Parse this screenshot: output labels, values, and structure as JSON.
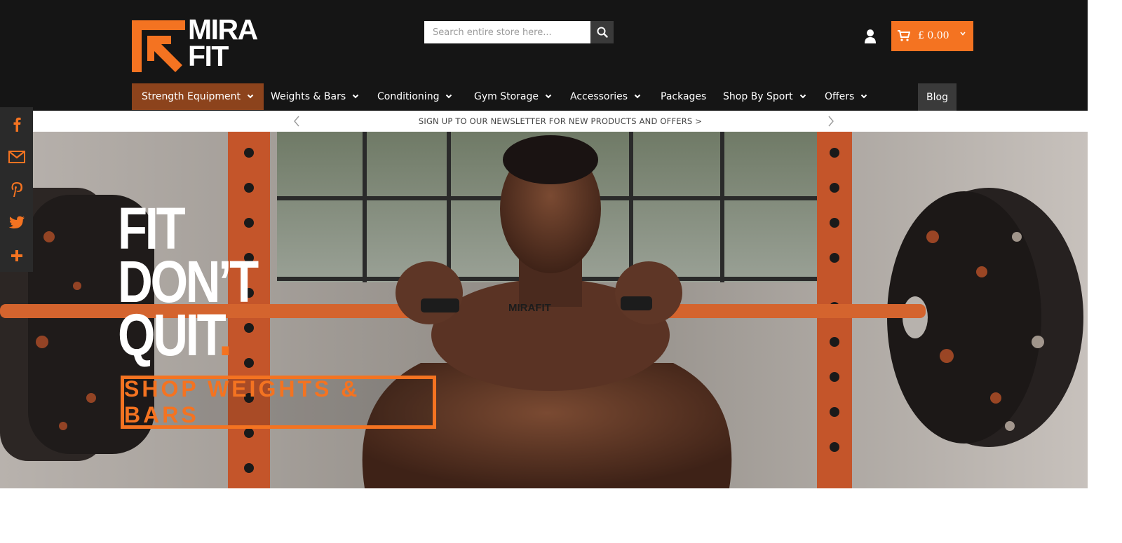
{
  "brand": {
    "logo_line1": "MIRA",
    "logo_line2": "FIT",
    "accent": "#f47321"
  },
  "search": {
    "placeholder": "Search entire store here..."
  },
  "cart": {
    "amount": "£ 0.00"
  },
  "nav": {
    "items": [
      {
        "label": "Strength Equipment"
      },
      {
        "label": "Weights & Bars"
      },
      {
        "label": "Conditioning"
      },
      {
        "label": "Gym Storage"
      },
      {
        "label": "Accessories"
      },
      {
        "label": "Packages"
      },
      {
        "label": "Shop By Sport"
      },
      {
        "label": "Offers"
      }
    ],
    "blog": "Blog"
  },
  "newsletter": {
    "text": "SIGN UP TO OUR NEWSLETTER FOR NEW PRODUCTS AND OFFERS >"
  },
  "social": {
    "icons": [
      "facebook-icon",
      "gmail-icon",
      "pinterest-icon",
      "twitter-icon",
      "more-icon"
    ]
  },
  "hero": {
    "line1": "FIT",
    "line2": "DON’T",
    "line3": "QUIT",
    "dot": ".",
    "cta": "SHOP WEIGHTS & BARS",
    "bar_brand": "MIRAFIT"
  }
}
